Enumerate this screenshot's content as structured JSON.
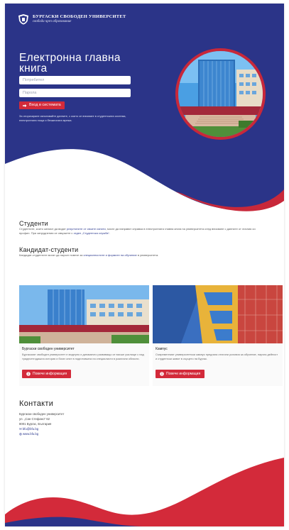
{
  "header": {
    "university_name": "БУРГАСКИ СВОБОДЕН УНИВЕРСИТЕТ",
    "motto": "свобода чрез образование"
  },
  "login": {
    "title": "Електронна главна книга",
    "username_placeholder": "Потребител",
    "password_placeholder": "Парола",
    "login_button": "Вход в системата",
    "note": "За оторизиране използвайте данните, с които се вписвате в студентската система, електронната поща и безжичната мрежа."
  },
  "students": {
    "title": "Студенти",
    "text_before": "Студентите, които желаят да видят",
    "link_1": "резултатите от своите изпити",
    "text_middle": ", могат да направят справка в електронната главна книга на университета след вписване с данните от личния си профил. При затруднения се свържете с",
    "link_2": "отдел „Студентска служба“",
    "text_after": "."
  },
  "candidates": {
    "title": "Кандидат-студенти",
    "text_before": "Кандидат-студентите могат да научат повече за",
    "link": "специалностите и формите на обучение",
    "text_after": "в университета."
  },
  "cards": [
    {
      "title": "Бургаски свободен университет",
      "text": "Бургаският свободен университет е модерно и динамично развиващо се висше училище с над тридесетгодишна история и богат опит в подготовката на специалисти в различни области.",
      "button": "Повече информация"
    },
    {
      "title": "Кампус",
      "text": "Съвременният университетски кампус предлага отлични условия за обучение, научна дейност и студентски живот в сърцето на Бургас.",
      "button": "Повече информация"
    }
  ],
  "contacts": {
    "title": "Контакти",
    "name": "Бургаски свободен университет",
    "address": "ул. „Сан Стефано“ 62",
    "city": "8001 Бургас, България",
    "email": "bfu@bfu.bg",
    "web": "www.bfu.bg"
  },
  "colors": {
    "navy": "#2b3488",
    "accent_red": "#d32a3a"
  }
}
